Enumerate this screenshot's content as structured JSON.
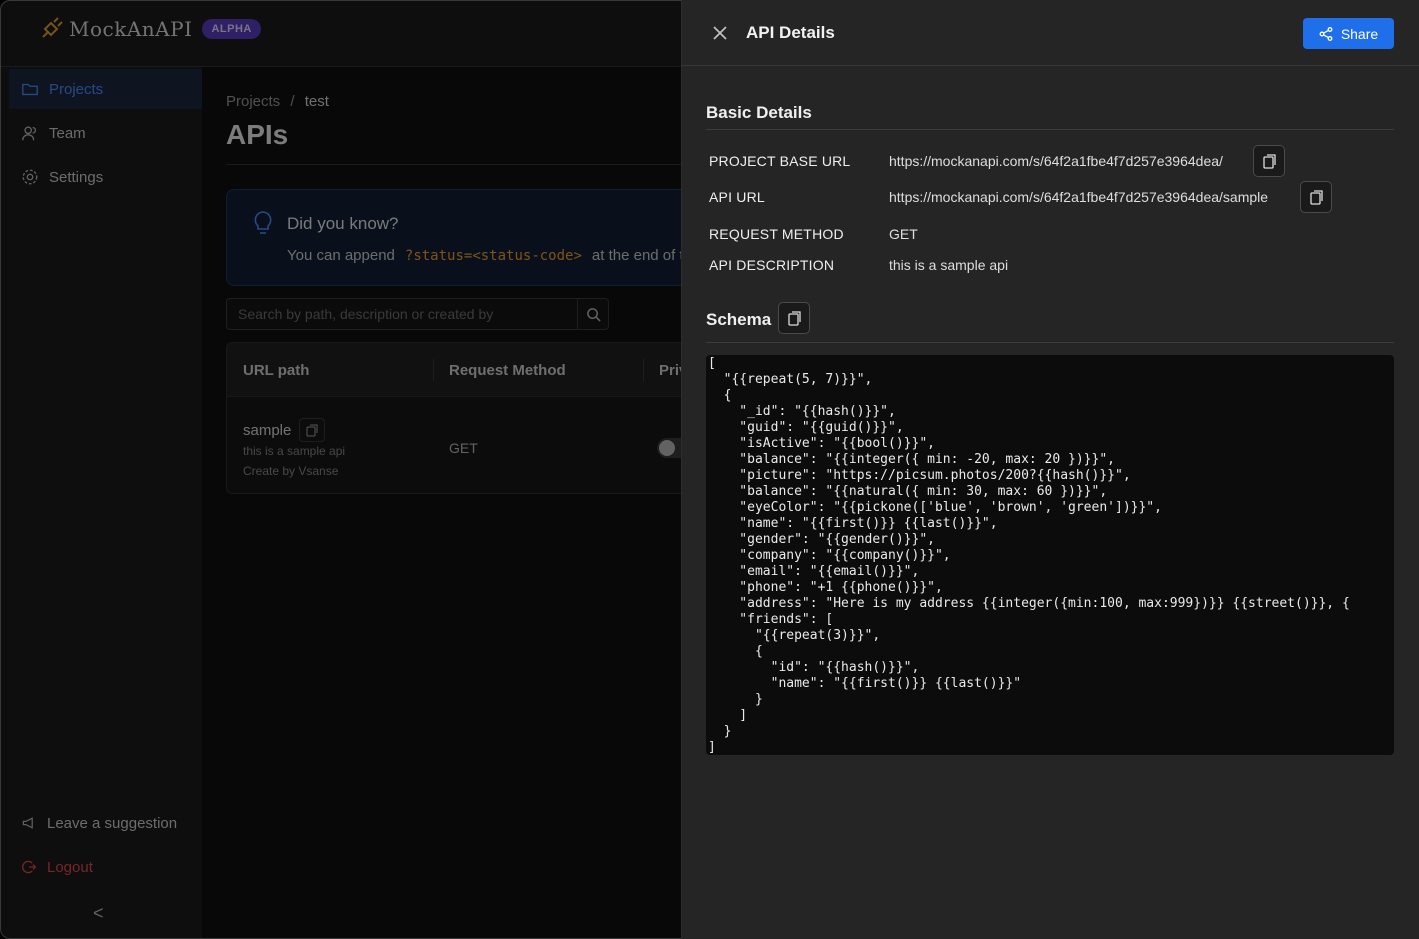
{
  "brand": {
    "name": "MockAnAPI",
    "badge": "ALPHA"
  },
  "sidebar": {
    "items": [
      {
        "label": "Projects",
        "icon": "folder-icon",
        "active": true
      },
      {
        "label": "Team",
        "icon": "team-icon",
        "active": false
      },
      {
        "label": "Settings",
        "icon": "gear-icon",
        "active": false
      }
    ],
    "suggestion_label": "Leave a suggestion",
    "logout_label": "Logout",
    "collapse_glyph": "<"
  },
  "main": {
    "breadcrumb": {
      "root": "Projects",
      "separator": "/",
      "current": "test"
    },
    "title": "APIs",
    "tip": {
      "title": "Did you know?",
      "text_before": "You can append",
      "code": "?status=<status-code>",
      "text_after": "at the end of t"
    },
    "search": {
      "placeholder": "Search by path, description or created by",
      "value": ""
    },
    "table": {
      "columns": [
        "URL path",
        "Request Method",
        "Priv"
      ],
      "rows": [
        {
          "path": "sample",
          "description": "this is a sample api",
          "created_by": "Create by Vsanse",
          "method": "GET",
          "private": false
        }
      ]
    }
  },
  "drawer": {
    "title": "API Details",
    "share_label": "Share",
    "basic_title": "Basic Details",
    "fields": {
      "base_url_label": "PROJECT BASE URL",
      "base_url": "https://mockanapi.com/s/64f2a1fbe4f7d257e3964dea/",
      "api_url_label": "API URL",
      "api_url": "https://mockanapi.com/s/64f2a1fbe4f7d257e3964dea/sample",
      "method_label": "REQUEST METHOD",
      "method": "GET",
      "description_label": "API DESCRIPTION",
      "description": "this is a sample api"
    },
    "schema_title": "Schema",
    "schema": "[\n  \"{{repeat(5, 7)}}\",\n  {\n    \"_id\": \"{{hash()}}\",\n    \"guid\": \"{{guid()}}\",\n    \"isActive\": \"{{bool()}}\",\n    \"balance\": \"{{integer({ min: -20, max: 20 })}}\",\n    \"picture\": \"https://picsum.photos/200?{{hash()}}\",\n    \"balance\": \"{{natural({ min: 30, max: 60 })}}\",\n    \"eyeColor\": \"{{pickone(['blue', 'brown', 'green'])}}\",\n    \"name\": \"{{first()}} {{last()}}\",\n    \"gender\": \"{{gender()}}\",\n    \"company\": \"{{company()}}\",\n    \"email\": \"{{email()}}\",\n    \"phone\": \"+1 {{phone()}}\",\n    \"address\": \"Here is my address {{integer({min:100, max:999})}} {{street()}}, {\n    \"friends\": [\n      \"{{repeat(3)}}\",\n      {\n        \"id\": \"{{hash()}}\",\n        \"name\": \"{{first()}} {{last()}}\"\n      }\n    ]\n  }\n]"
  },
  "colors": {
    "accent": "#1f6feb",
    "active_nav": "#4d8bff",
    "logout": "#e5484d",
    "badge": "#5b3cc4",
    "code_highlight": "#f0a030"
  }
}
